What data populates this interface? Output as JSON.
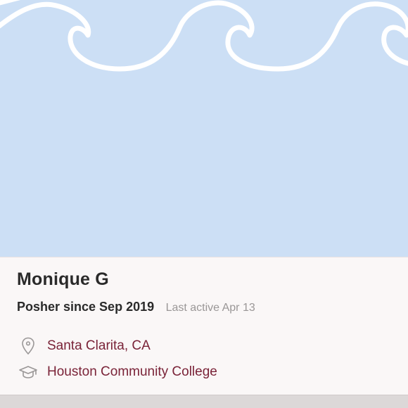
{
  "profile": {
    "name": "Monique G",
    "posher_since": "Posher since Sep 2019",
    "last_active": "Last active Apr 13",
    "location": "Santa Clarita, CA",
    "education": "Houston Community College"
  },
  "icons": {
    "location": "map-pin-icon",
    "education": "graduation-cap-icon"
  },
  "colors": {
    "cover_background": "#ccdff5",
    "wave_stroke": "#ffffff",
    "link_text": "#7a2338",
    "muted_text": "#9a9797",
    "primary_text": "#2a2a2a"
  }
}
